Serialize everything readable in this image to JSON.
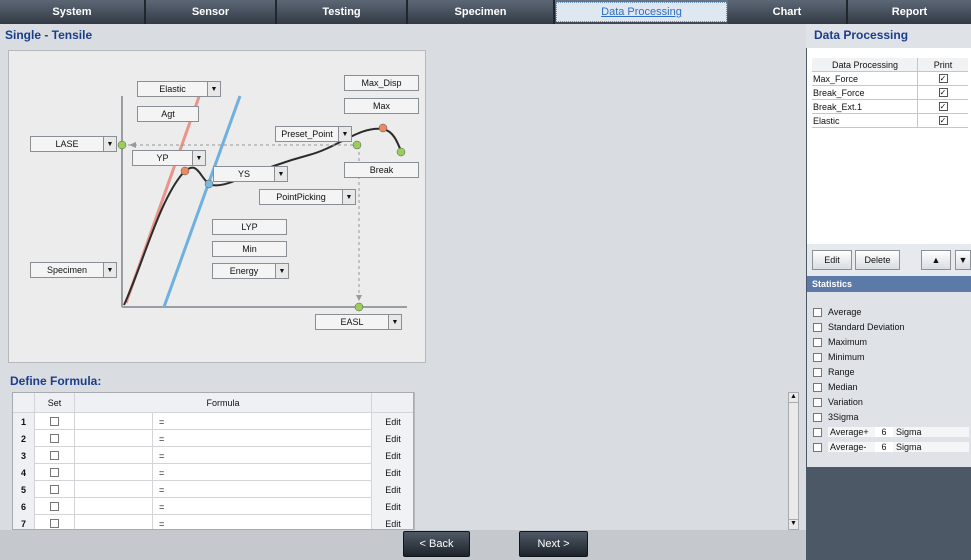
{
  "tabs": [
    {
      "label": "System"
    },
    {
      "label": "Sensor"
    },
    {
      "label": "Testing"
    },
    {
      "label": "Specimen"
    },
    {
      "label": "Data Processing",
      "active": true
    },
    {
      "label": "Chart"
    },
    {
      "label": "Report"
    }
  ],
  "left": {
    "title": "Single - Tensile",
    "diagram": {
      "elastic": "Elastic",
      "agt": "Agt",
      "lase": "LASE",
      "yp": "YP",
      "ys": "YS",
      "max_disp": "Max_Disp",
      "max": "Max",
      "preset_point": "Preset_Point",
      "break": "Break",
      "point_picking": "PointPicking",
      "lyp": "LYP",
      "min": "Min",
      "energy": "Energy",
      "specimen": "Specimen",
      "easl": "EASL"
    },
    "formula": {
      "title": "Define Formula:",
      "col_set": "Set",
      "col_formula": "Formula",
      "rows": [
        {
          "num": "1",
          "eq": "=",
          "edit": "Edit"
        },
        {
          "num": "2",
          "eq": "=",
          "edit": "Edit"
        },
        {
          "num": "3",
          "eq": "=",
          "edit": "Edit"
        },
        {
          "num": "4",
          "eq": "=",
          "edit": "Edit"
        },
        {
          "num": "5",
          "eq": "=",
          "edit": "Edit"
        },
        {
          "num": "6",
          "eq": "=",
          "edit": "Edit"
        },
        {
          "num": "7",
          "eq": "=",
          "edit": "Edit"
        }
      ]
    }
  },
  "nav": {
    "back": "< Back",
    "next": "Next >"
  },
  "right": {
    "title": "Data Processing",
    "table": {
      "col_name": "Data Processing",
      "col_print": "Print",
      "rows": [
        {
          "name": "Max_Force",
          "print": "✓"
        },
        {
          "name": "Break_Force",
          "print": "✓"
        },
        {
          "name": "Break_Ext.1",
          "print": "✓"
        },
        {
          "name": "Elastic",
          "print": "✓"
        }
      ]
    },
    "buttons": {
      "edit": "Edit",
      "delete": "Delete",
      "up": "▲",
      "down": "▼"
    },
    "statistics": {
      "title": "Statistics",
      "items": [
        "Average",
        "Standard Deviation",
        "Maximum",
        "Minimum",
        "Range",
        "Median",
        "Variation",
        "3Sigma"
      ],
      "avg_plus": {
        "label": "Average+",
        "value": "6",
        "unit": "Sigma"
      },
      "avg_minus": {
        "label": "Average-",
        "value": "6",
        "unit": "Sigma"
      }
    }
  },
  "colors": {
    "accent": "#1b3e8a",
    "curve_red": "#e8948a",
    "curve_blue": "#6fb0dd"
  }
}
